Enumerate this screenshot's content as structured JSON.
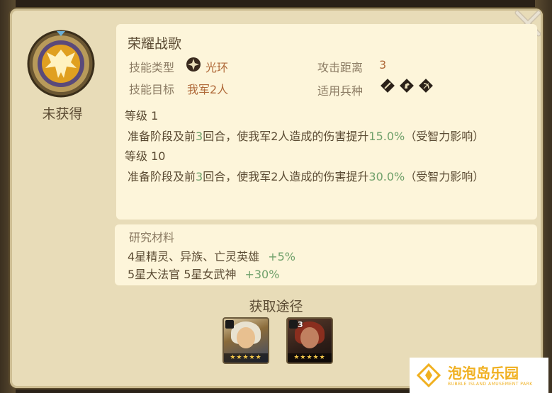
{
  "skill": {
    "name": "荣耀战歌",
    "status": "未获得",
    "type_label": "技能类型",
    "type_value": "光环",
    "target_label": "技能目标",
    "target_value": "我军2人",
    "range_label": "攻击距离",
    "range_value": "3",
    "troop_label": "适用兵种"
  },
  "levels": [
    {
      "label": "等级 1",
      "desc_prefix": "准备阶段及前",
      "desc_rounds": "3",
      "desc_mid": "回合，使我军2人造成的伤害提升",
      "desc_value": "15.0%",
      "desc_suffix": "（受智力影响）"
    },
    {
      "label": "等级 10",
      "desc_prefix": "准备阶段及前",
      "desc_rounds": "3",
      "desc_mid": "回合，使我军2人造成的伤害提升",
      "desc_value": "30.0%",
      "desc_suffix": "（受智力影响）"
    }
  ],
  "materials": {
    "title": "研究材料",
    "rows": [
      {
        "text": "4星精灵、异族、亡灵英雄",
        "bonus": "+5%"
      },
      {
        "text": "5星大法官 5星女武神",
        "bonus": "+30%"
      }
    ]
  },
  "obtain": {
    "title": "获取途径",
    "heroes": [
      {
        "tier": "",
        "stars": "★★★★★"
      },
      {
        "tier": "3",
        "stars": "★★★★★"
      }
    ]
  },
  "watermark": {
    "text": "泡泡岛乐园",
    "sub": "BUBBLE ISLAND AMUSEMENT PARK"
  },
  "icons": [
    "close-icon",
    "winged-emblem-icon",
    "aura-type-icon",
    "sword-troop-icon",
    "horse-troop-icon",
    "bow-troop-icon"
  ],
  "colors": {
    "accent_green": "#6fa06a",
    "accent_orange": "#b06a3a",
    "panel": "#e8dcb8",
    "card": "#fdf5da"
  }
}
